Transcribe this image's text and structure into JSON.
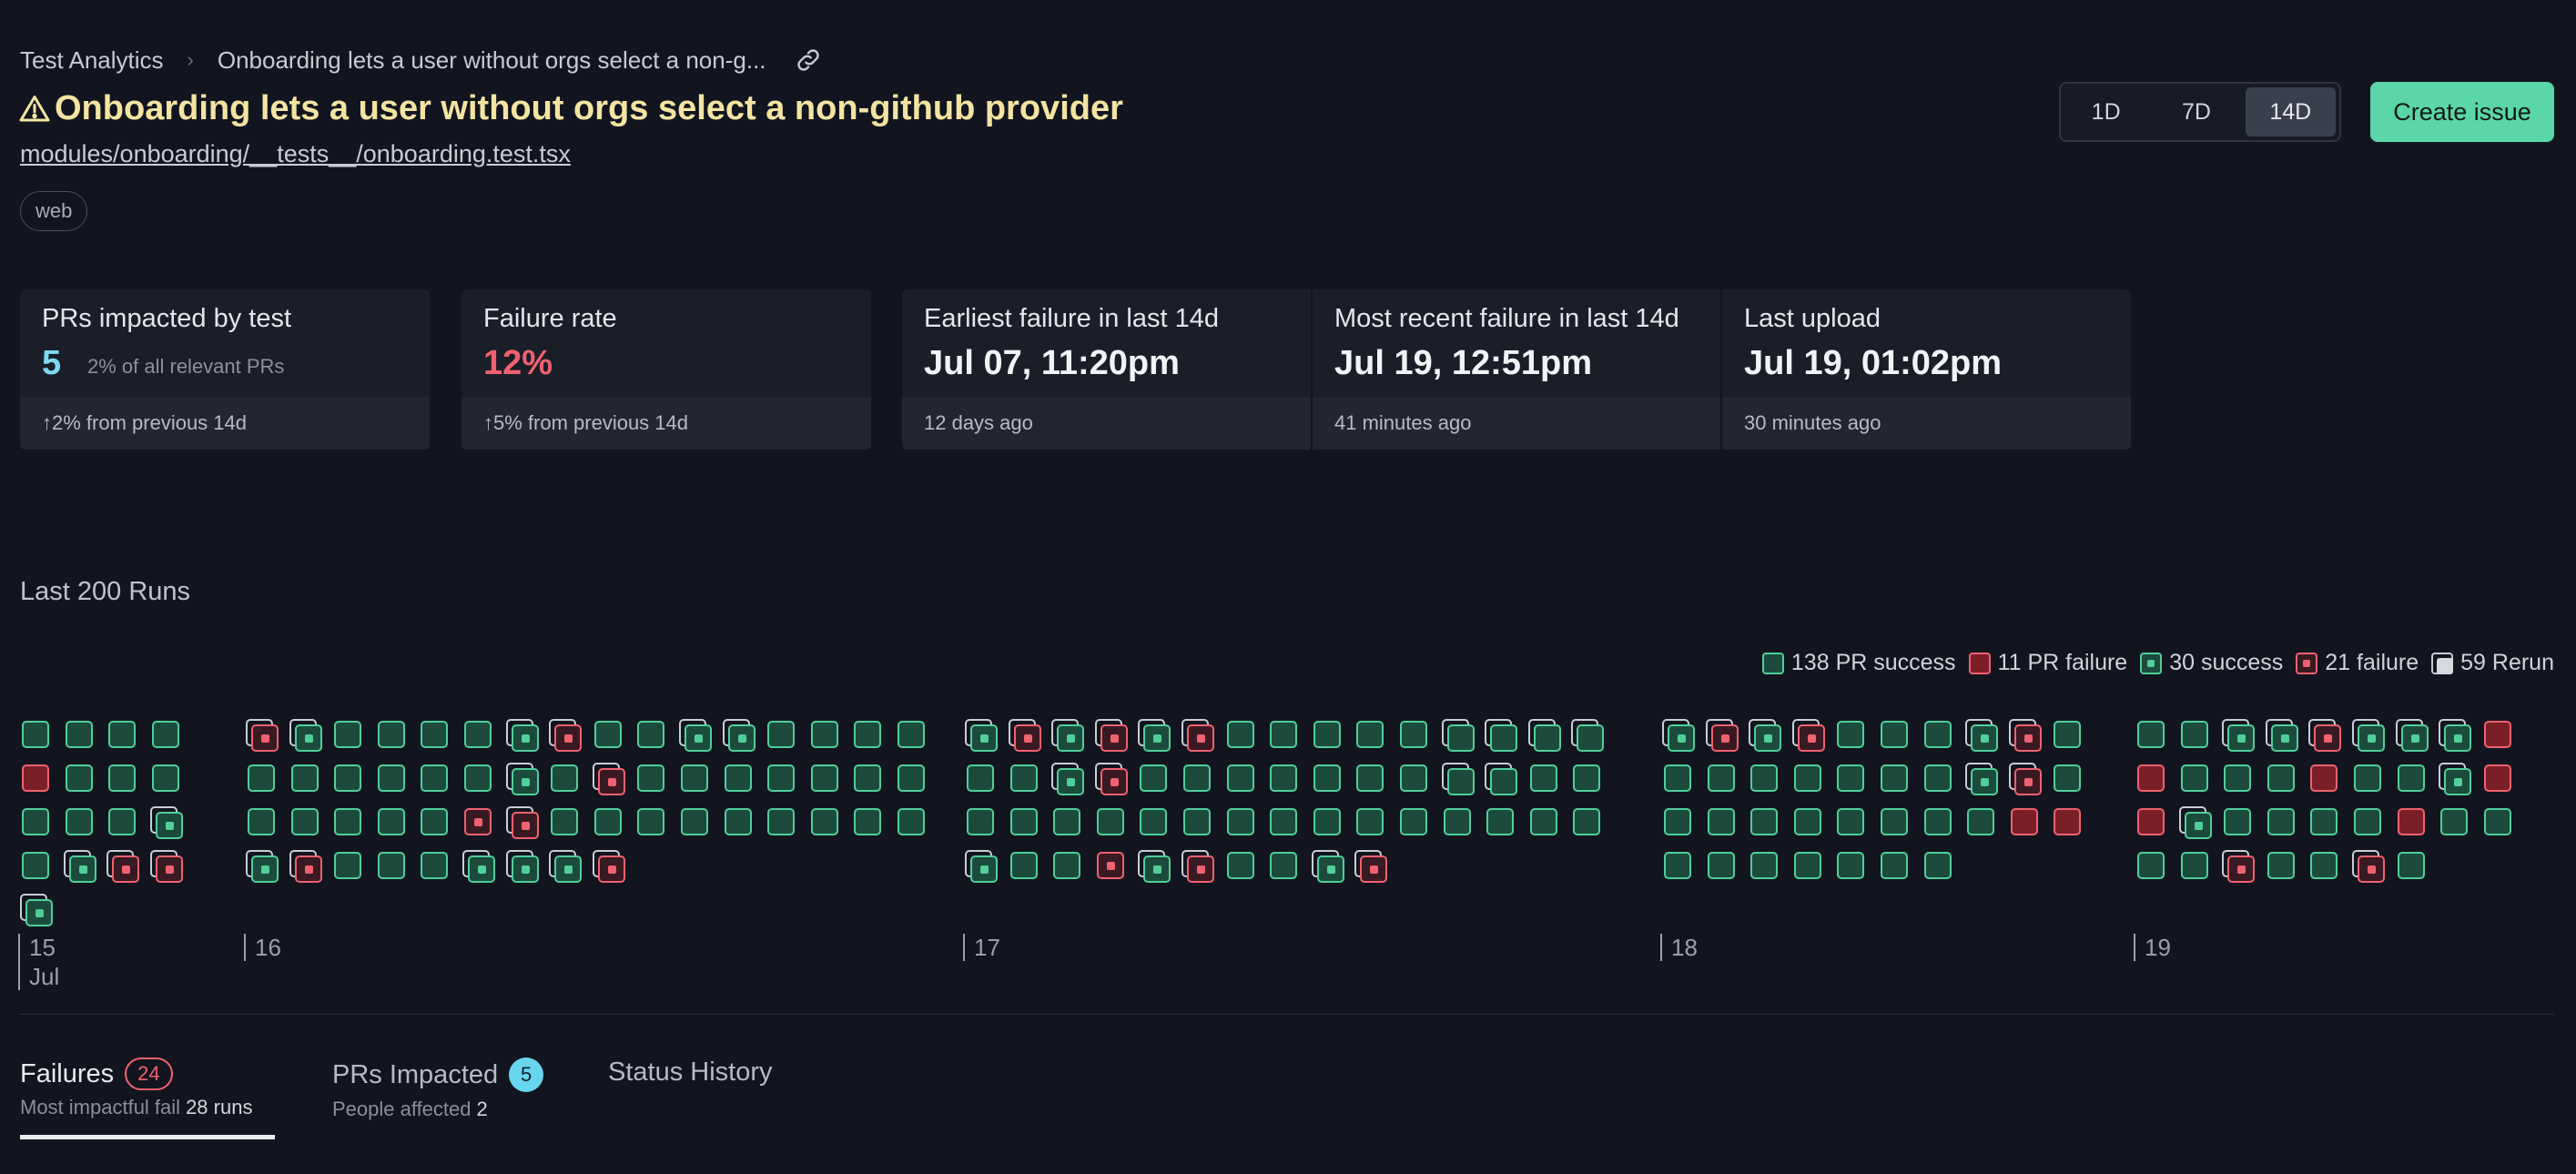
{
  "breadcrumb": {
    "root": "Test Analytics",
    "separator": "›",
    "current": "Onboarding lets a user without orgs select a non-g..."
  },
  "title": "Onboarding lets a user without orgs select a non-github provider",
  "file_path": "modules/onboarding/__tests__/onboarding.test.tsx",
  "tag": "web",
  "range": {
    "options": [
      "1D",
      "7D",
      "14D"
    ],
    "selected": "14D"
  },
  "create_issue_label": "Create issue",
  "cards": {
    "prs": {
      "label": "PRs impacted by test",
      "value": "5",
      "sub": "2% of all relevant PRs",
      "foot": "↑2% from previous 14d"
    },
    "failure_rate": {
      "label": "Failure rate",
      "value": "12%",
      "foot": "↑5% from previous 14d"
    },
    "earliest": {
      "label": "Earliest failure in last 14d",
      "value": "Jul 07, 11:20pm",
      "foot": "12 days ago"
    },
    "recent": {
      "label": "Most recent failure in last 14d",
      "value": "Jul 19, 12:51pm",
      "foot": "41 minutes ago"
    },
    "upload": {
      "label": "Last upload",
      "value": "Jul 19, 01:02pm",
      "foot": "30 minutes ago"
    }
  },
  "runs_title": "Last 200 Runs",
  "legend": {
    "pr_success": "138 PR success",
    "pr_failure": "11 PR failure",
    "success": "30 success",
    "failure": "21 failure",
    "rerun": "59 Rerun"
  },
  "run_grid": {
    "legend_codes": {
      "g": "PR success",
      "r": "PR failure",
      "gd": "success",
      "rd": "failure",
      "rerun": "stacked behind = rerun"
    },
    "days": [
      {
        "label": "15",
        "month": "Jul",
        "columns": [
          [
            "g",
            "r",
            "g",
            "g",
            "gd*"
          ],
          [
            "g",
            "g",
            "g",
            "gd*"
          ],
          [
            "g",
            "g",
            "g",
            "rd*"
          ],
          [
            "g",
            "g",
            "gd*",
            "rd*"
          ]
        ]
      },
      {
        "label": "16",
        "columns": [
          [
            "rd*",
            "g",
            "g",
            "gd*"
          ],
          [
            "gd*",
            "g",
            "g",
            "rd*"
          ],
          [
            "g",
            "g",
            "g",
            "g"
          ],
          [
            "g",
            "g",
            "g",
            "g"
          ],
          [
            "g",
            "g",
            "g",
            "g"
          ],
          [
            "g",
            "g",
            "rd",
            "gd*"
          ],
          [
            "gd*",
            "gd*",
            "rd*",
            "gd*"
          ],
          [
            "rd*",
            "g",
            "g",
            "gd*"
          ],
          [
            "g",
            "rd*",
            "g",
            "rd*"
          ],
          [
            "g",
            "g",
            "g"
          ],
          [
            "gd*",
            "g",
            "g"
          ],
          [
            "gd*",
            "g",
            "g"
          ],
          [
            "g",
            "g",
            "g"
          ],
          [
            "g",
            "g",
            "g"
          ],
          [
            "g",
            "g",
            "g"
          ],
          [
            "g",
            "g",
            "g"
          ]
        ]
      },
      {
        "label": "17",
        "columns": [
          [
            "gd*",
            "g",
            "g",
            "gd*"
          ],
          [
            "rd*",
            "g",
            "g",
            "g"
          ],
          [
            "gd*",
            "gd*",
            "g",
            "g"
          ],
          [
            "rd*",
            "rd*",
            "g",
            "rd"
          ],
          [
            "gd*",
            "g",
            "g",
            "gd*"
          ],
          [
            "rd*",
            "g",
            "g",
            "rd*"
          ],
          [
            "g",
            "g",
            "g",
            "g"
          ],
          [
            "g",
            "g",
            "g",
            "g"
          ],
          [
            "g",
            "g",
            "g",
            "gd*"
          ],
          [
            "g",
            "g",
            "g",
            "rd*"
          ],
          [
            "g",
            "g",
            "g"
          ],
          [
            "g*",
            "g*",
            "g"
          ],
          [
            "g*",
            "g*",
            "g"
          ],
          [
            "g*",
            "g",
            "g"
          ],
          [
            "g*",
            "g",
            "g"
          ]
        ]
      },
      {
        "label": "18",
        "columns": [
          [
            "gd*",
            "g",
            "g",
            "g"
          ],
          [
            "rd*",
            "g",
            "g",
            "g"
          ],
          [
            "gd*",
            "g",
            "g",
            "g"
          ],
          [
            "rd*",
            "g",
            "g",
            "g"
          ],
          [
            "g",
            "g",
            "g",
            "g"
          ],
          [
            "g",
            "g",
            "g",
            "g"
          ],
          [
            "g",
            "g",
            "g",
            "g"
          ],
          [
            "gd*",
            "gd*",
            "g"
          ],
          [
            "rd*",
            "rd*",
            "r"
          ],
          [
            "g",
            "g",
            "r"
          ]
        ]
      },
      {
        "label": "19",
        "columns": [
          [
            "g",
            "r",
            "r",
            "g"
          ],
          [
            "g",
            "g",
            "gd*",
            "g"
          ],
          [
            "gd*",
            "g",
            "g",
            "rd*"
          ],
          [
            "gd*",
            "g",
            "g",
            "g"
          ],
          [
            "rd*",
            "r",
            "g",
            "g"
          ],
          [
            "gd*",
            "g",
            "g",
            "rd*"
          ],
          [
            "gd*",
            "g",
            "r",
            "g"
          ],
          [
            "gd*",
            "gd*",
            "g"
          ],
          [
            "r",
            "r",
            "g"
          ]
        ]
      }
    ]
  },
  "tabs": {
    "failures": {
      "label": "Failures",
      "count": "24",
      "sub_label": "Most impactful fail",
      "sub_value": "28 runs"
    },
    "prs": {
      "label": "PRs Impacted",
      "count": "5",
      "sub_label": "People affected",
      "sub_value": "2"
    },
    "history": {
      "label": "Status History"
    }
  },
  "colors": {
    "background": "#12151f",
    "success": "#4fcf99",
    "failure": "#f0616f",
    "title": "#f4e4a2",
    "accent_button": "#5ad6a8"
  }
}
